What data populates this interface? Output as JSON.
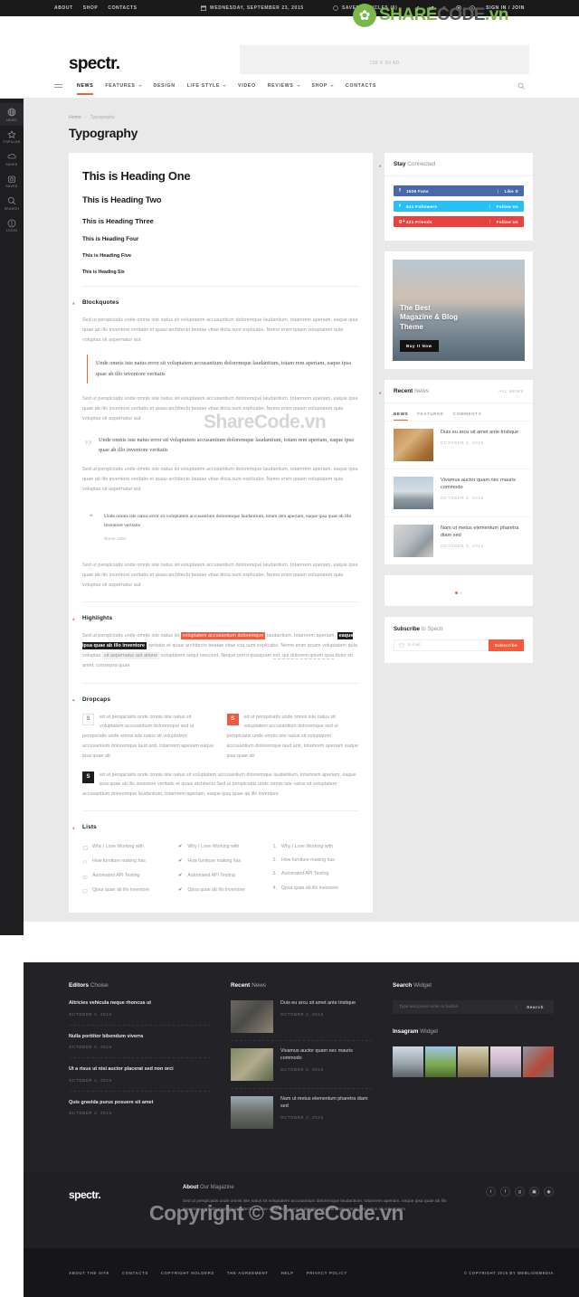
{
  "topbar": {
    "links": [
      "About",
      "Shop",
      "Contacts"
    ],
    "date": "Wednesday, September 23, 2015",
    "saved": "Saved Articles (5)",
    "signin": "Sign In / Join",
    "social": [
      "facebook",
      "twitter",
      "google-plus",
      "instagram",
      "rss"
    ]
  },
  "header": {
    "logo": "spectr.",
    "ad_label": "728 X 90 AD"
  },
  "nav": {
    "items": [
      {
        "label": "News",
        "caret": false,
        "active": true
      },
      {
        "label": "Features",
        "caret": true,
        "active": false
      },
      {
        "label": "Design",
        "caret": false,
        "active": false
      },
      {
        "label": "Life Style",
        "caret": true,
        "active": false
      },
      {
        "label": "Video",
        "caret": false,
        "active": false
      },
      {
        "label": "Reviews",
        "caret": true,
        "active": false
      },
      {
        "label": "Shop",
        "caret": true,
        "active": false
      },
      {
        "label": "Contacts",
        "caret": false,
        "active": false
      }
    ]
  },
  "rail": {
    "items": [
      {
        "label": "News",
        "icon": "globe-icon",
        "active": true
      },
      {
        "label": "Popular",
        "icon": "star-icon",
        "active": false
      },
      {
        "label": "Saved",
        "icon": "cloud-icon",
        "active": false
      },
      {
        "label": "Saved",
        "icon": "clock-icon",
        "active": false
      },
      {
        "label": "Search",
        "icon": "search-icon",
        "active": false
      },
      {
        "label": "Login",
        "icon": "user-icon",
        "active": false
      }
    ]
  },
  "breadcrumb": {
    "home": "Home",
    "sep": "›",
    "current": "Typography"
  },
  "page_title": "Typography",
  "headings": [
    "This is Heading One",
    "This is Heading Two",
    "This is Heading Three",
    "This is Heading Four",
    "This is Heading Five",
    "This is Heading Six"
  ],
  "blockquotes": {
    "title": "Blockquotes",
    "para": "Sed ut perspiciatis unde omnis iste natus sit voluptatem accusantium doloremque laudantium, totamrem aperiam, eaque ipsa quae ab illo inventore veritatis et quasi architecto beatae vitae dicta sunt explicabo. Nemo enim ipsam voluptatem quia voluptas sit aspernatur aut",
    "quote": "Unde omnis iste natus error sit voluptatem accusantium doloremque laudantium, totam rem aperiam, eaque ipsa quae ab illo inventore veritatis",
    "cite": "Steve Jobs"
  },
  "highlights": {
    "title": "Highlights",
    "p1": "Sed ut perspiciatis unde omnis iste natus sit ",
    "mark_red": "voluptatem accusantium doloremque",
    "p2": " laudantium, totamrem aperiam, ",
    "mark_dark": "eaque ipsa quae ab illo inventore",
    "p3": " veritatis et quasi architecto beatae vitae icta sunt explicabo. Nemo enim ipsam voluptatem quia voluptas ",
    "mark_grey": "sit aspernatur aut atione",
    "p4": " voluptatem sequi nesciunt. Neque porro quisquam ",
    "mark_dash": "est, qui dolorem ipsum quia",
    "p5": " dolor sit amet, consepsa quae"
  },
  "dropcaps": {
    "title": "Dropcaps",
    "letter": "S",
    "col1": "ed ut perspiciatis unde omnis iste natus sit voluptatem accusantium doloremque sed ut perspiciatis unde omnis iste natus sit voluptatem accusantium doloremque laud anti, totamrem aperiam eaque ipsa quae ab",
    "col2": "ed ut perspiciatis unde omnis iste natus sit voluptatem accusantium doloremque sed ut perspiciatis unde omnis iste natus sit voluptatem accusantium doloremque laud anti, totamrem aperiam eaque ipsa quae ab",
    "wide": "ed ut perspiciatis unde omnis iste natus sit voluptatem accusantium doloremque laudantium, totamrem aperiam, eaque ipsa quae ab illo inventore veritatis et quasi architecto Sed ut perspiciatis unde omnis iste natus sit voluptatem accusantium doloremque laudantium, totamrem aperiam, eaque ipsa quae ab illo inventore"
  },
  "lists": {
    "title": "Lists",
    "items": [
      "Why I Love Working with",
      "How furniture making has",
      "Automated API Testing",
      "Qpsa quae ab illo inventore"
    ],
    "icon_col": [
      "screen-icon",
      "cloud-icon",
      "camera-icon",
      "monitor-icon"
    ],
    "tick": "✔",
    "numbers": [
      "1.",
      "2.",
      "3.",
      "4."
    ]
  },
  "sidebar": {
    "connected": {
      "title_b": "Stay",
      "title_l": " Connected",
      "rows": [
        {
          "glyph": "f",
          "count": "1526 Fans",
          "cta": "Like It",
          "network": "facebook"
        },
        {
          "glyph": "t",
          "count": "541 Followers",
          "cta": "Follow Us",
          "network": "twitter"
        },
        {
          "glyph": "g+",
          "count": "421 Friends",
          "cta": "Follow Us",
          "network": "google-plus"
        }
      ]
    },
    "promo": {
      "title": "The Best\nMagazine & Blog\nTheme",
      "button": "Buy It Now"
    },
    "recent": {
      "title_b": "Recent",
      "title_l": " News",
      "all": "All News",
      "tabs": [
        "News",
        "Featured",
        "Comments"
      ],
      "items": [
        {
          "title": "Duis eu arcu sit amet ante tristique",
          "date": "October 2,  2015"
        },
        {
          "title": "Vivamus auctor quam nec mauris commodo",
          "date": "October 2,  2015"
        },
        {
          "title": "Nam ut metus elementum pharetra diam sed",
          "date": "October 2,  2015"
        }
      ],
      "pager": "0"
    },
    "subscribe": {
      "title_b": "Subscribe",
      "title_l": " to Spectr",
      "placeholder": "E-mail",
      "button": "Subscribe"
    }
  },
  "footer": {
    "editors": {
      "title_b": "Editors",
      "title_l": " Choise",
      "items": [
        {
          "title": "Altricies vehicula neque rhoncus ut",
          "date": "October 2,  2015"
        },
        {
          "title": "Nulla porttitor bibendum viverra",
          "date": "October 2,  2015"
        },
        {
          "title": "Ut a risus ut nisi auctor placerat sed non orci",
          "date": "October 2,  2015"
        },
        {
          "title": "Quis gravida purus posuere sit amet",
          "date": "October 2,  2015"
        }
      ]
    },
    "recent": {
      "title_b": "Recent",
      "title_l": " News",
      "items": [
        {
          "title": "Duis eu arcu sit amet ante tristique",
          "date": "October 2,  2015"
        },
        {
          "title": "Vivamus auctor quam nec mauris commodo",
          "date": "October 2,  2015"
        },
        {
          "title": "Nam ut metus elementum pharetra diam sed",
          "date": "October 2,  2015"
        }
      ]
    },
    "search": {
      "title_b": "Search",
      "title_l": " Widget",
      "placeholder": "Type and press enter or button",
      "button": "Search"
    },
    "instagram": {
      "title_b": "Insagram",
      "title_l": " Widget"
    },
    "brand": "spectr.",
    "about": {
      "title_b": "About",
      "title_l": " Our Magazine",
      "text": "Sed ut perspiciatis unde omnis iste natus sit voluptatem accusantium doloremque laudantium, totamrem aperiam, eaque ipsa quae ab illo inventore veritatis et quasi architecto beatae vitae dicta sunt explicabo spiciatis unde omnis iste natus sit voluptatem"
    },
    "social": [
      "twitter",
      "facebook",
      "google-plus",
      "instagram",
      "rss"
    ],
    "legal_links": [
      "About The Site",
      "Contacts",
      "Copyright Holders",
      "The Agreement",
      "Help",
      "Privacy Policy"
    ],
    "copyright": "© Copyright 2015 by Weblionmedia"
  },
  "watermarks": {
    "logo_a": "SHARE",
    "logo_b": "CODE",
    "logo_c": ".vn",
    "mid": "ShareCode.vn",
    "bottom": "Copyright © ShareCode.vn",
    "green": "#7ab648"
  }
}
